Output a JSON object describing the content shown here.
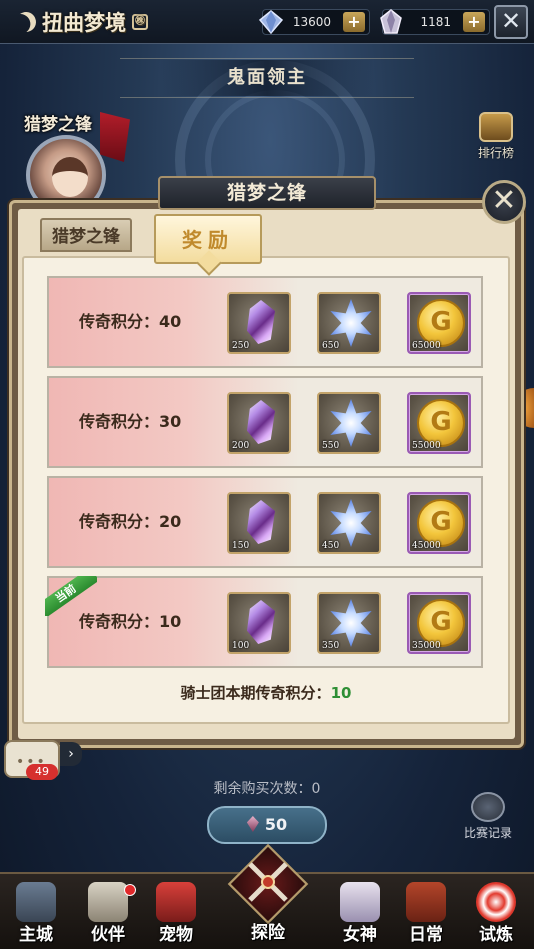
{
  "topbar": {
    "title": "扭曲梦境",
    "title_badge": "㊑",
    "diamond_amount": "13600",
    "crystal_amount": "1181",
    "plus_label": "+",
    "close_label": "✕"
  },
  "scene": {
    "boss_name": "鬼面领主",
    "hero_label": "猎梦之锋",
    "rank_label": "排行榜"
  },
  "dialog": {
    "title": "猎梦之锋",
    "close_label": "✕",
    "tabs": [
      {
        "label": "猎梦之锋",
        "active": false
      },
      {
        "label": "奖励",
        "active": true
      }
    ],
    "current_tag": "当前",
    "rows": [
      {
        "label": "传奇积分：40",
        "items": [
          {
            "icon": "crystal-icon",
            "qty": "250"
          },
          {
            "icon": "star-crystal-icon",
            "qty": "650"
          },
          {
            "icon": "gold-coin-icon",
            "qty": "65000"
          }
        ],
        "current": false
      },
      {
        "label": "传奇积分：30",
        "items": [
          {
            "icon": "crystal-icon",
            "qty": "200"
          },
          {
            "icon": "star-crystal-icon",
            "qty": "550"
          },
          {
            "icon": "gold-coin-icon",
            "qty": "55000"
          }
        ],
        "current": false
      },
      {
        "label": "传奇积分：20",
        "items": [
          {
            "icon": "crystal-icon",
            "qty": "150"
          },
          {
            "icon": "star-crystal-icon",
            "qty": "450"
          },
          {
            "icon": "gold-coin-icon",
            "qty": "45000"
          }
        ],
        "current": false
      },
      {
        "label": "传奇积分：10",
        "items": [
          {
            "icon": "crystal-icon",
            "qty": "100"
          },
          {
            "icon": "star-crystal-icon",
            "qty": "350"
          },
          {
            "icon": "gold-coin-icon",
            "qty": "35000"
          }
        ],
        "current": true
      }
    ],
    "summary_label": "骑士团本期传奇积分：",
    "summary_value": "10"
  },
  "below": {
    "chat_badge": "49",
    "chat_dots": "•••",
    "chat_arrow": "›",
    "remaining_label": "剩余购买次数：0",
    "buy_price": "50",
    "record_label": "比赛记录"
  },
  "nav": {
    "items": [
      {
        "label": "主城",
        "icon": "castle-icon",
        "dot": false
      },
      {
        "label": "伙伴",
        "icon": "knight-icon",
        "dot": true
      },
      {
        "label": "宠物",
        "icon": "dragon-icon",
        "dot": false
      },
      {
        "label": "探险",
        "icon": "crossed-swords-icon",
        "dot": false,
        "center": true
      },
      {
        "label": "女神",
        "icon": "goddess-icon",
        "dot": false
      },
      {
        "label": "日常",
        "icon": "book-icon",
        "dot": false
      },
      {
        "label": "试炼",
        "icon": "target-icon",
        "dot": false
      }
    ]
  },
  "colors": {
    "accent_gold": "#c08a2c",
    "summary_green": "#2e8f35",
    "badge_red": "#d6302e"
  }
}
